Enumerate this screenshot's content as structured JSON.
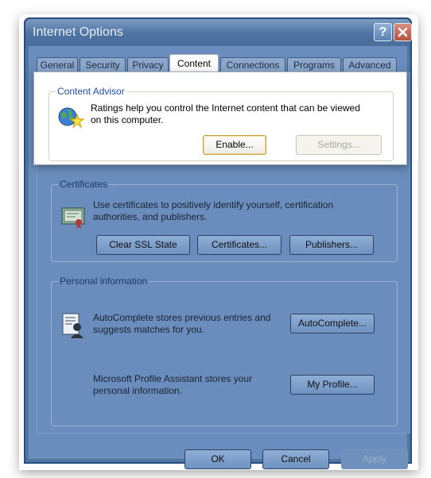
{
  "window": {
    "title": "Internet Options",
    "help_label": "?",
    "close_label": "✕"
  },
  "tabs": [
    {
      "label": "General"
    },
    {
      "label": "Security"
    },
    {
      "label": "Privacy"
    },
    {
      "label": "Content"
    },
    {
      "label": "Connections"
    },
    {
      "label": "Programs"
    },
    {
      "label": "Advanced"
    }
  ],
  "active_tab": "Content",
  "content_advisor": {
    "label": "Content Advisor",
    "description": "Ratings help you control the Internet content that can be viewed on this computer.",
    "enable_label": "Enable...",
    "settings_label": "Settings..."
  },
  "certificates": {
    "label": "Certificates",
    "description": "Use certificates to positively identify yourself, certification authorities, and publishers.",
    "clear_ssl_label": "Clear SSL State",
    "certificates_label": "Certificates...",
    "publishers_label": "Publishers..."
  },
  "personal_information": {
    "label": "Personal information",
    "autocomplete_text": "AutoComplete stores previous entries and suggests matches for you.",
    "autocomplete_label": "AutoComplete...",
    "profile_text": "Microsoft Profile Assistant stores your personal information.",
    "profile_label": "My Profile..."
  },
  "footer": {
    "ok_label": "OK",
    "cancel_label": "Cancel",
    "apply_label": "Apply"
  },
  "icons": {
    "content_advisor": "globe-star-icon",
    "certificates": "certificate-icon",
    "autocomplete": "autocomplete-icon"
  }
}
